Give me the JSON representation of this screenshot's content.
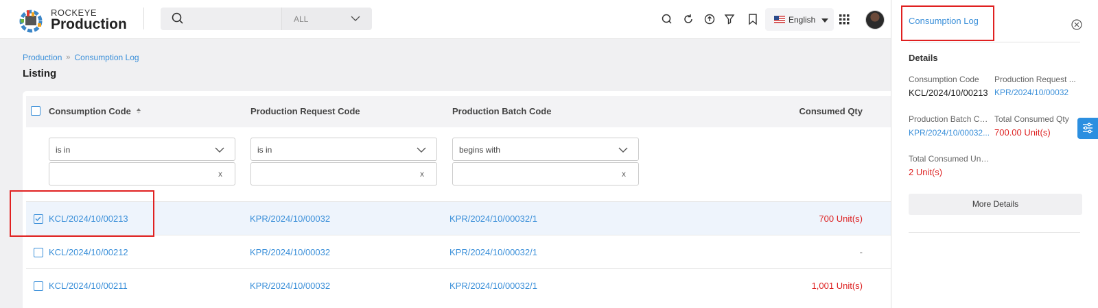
{
  "brand": {
    "small": "ROCKEYE",
    "big": "Production"
  },
  "search": {
    "placeholder": "",
    "scope": "ALL"
  },
  "language": {
    "label": "English"
  },
  "breadcrumb": {
    "root": "Production",
    "current": "Consumption Log",
    "sep": "»"
  },
  "page_title": "Listing",
  "columns": {
    "code": "Consumption Code",
    "request": "Production Request Code",
    "batch": "Production Batch Code",
    "qty": "Consumed Qty"
  },
  "filters": {
    "code_op": "is in",
    "request_op": "is in",
    "batch_op": "begins with",
    "clear": "x"
  },
  "rows": [
    {
      "code": "KCL/2024/10/00213",
      "request": "KPR/2024/10/00032",
      "batch": "KPR/2024/10/00032/1",
      "qty": "700 Unit(s)"
    },
    {
      "code": "KCL/2024/10/00212",
      "request": "KPR/2024/10/00032",
      "batch": "KPR/2024/10/00032/1",
      "qty": "-"
    },
    {
      "code": "KCL/2024/10/00211",
      "request": "KPR/2024/10/00032",
      "batch": "KPR/2024/10/00032/1",
      "qty": "1,001 Unit(s)"
    }
  ],
  "panel": {
    "title": "Consumption Log",
    "section": "Details",
    "fields": {
      "code_label": "Consumption Code",
      "code_value": "KCL/2024/10/00213",
      "request_label": "Production Request ...",
      "request_value": "KPR/2024/10/00032",
      "batch_label": "Production Batch Co...",
      "batch_value": "KPR/2024/10/00032...",
      "total_qty_label": "Total Consumed Qty",
      "total_qty_value": "700.00 Unit(s)",
      "total_unit_label": "Total Consumed Unit...",
      "total_unit_value": "2 Unit(s)"
    },
    "more_button": "More Details"
  },
  "colors": {
    "accent": "#3a8fd9",
    "danger": "#dd2222",
    "annotation": "#e02020"
  },
  "icons": [
    "search-icon",
    "refresh-icon",
    "upload-icon",
    "filter-icon",
    "bookmark-icon",
    "apps-grid-icon",
    "close-icon",
    "settings-sliders-icon"
  ]
}
